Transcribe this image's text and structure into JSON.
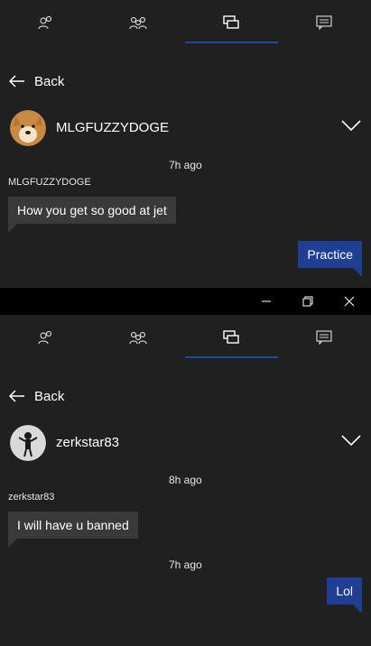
{
  "colors": {
    "background": "#202020",
    "accent": "#1f4a9c",
    "bubble_in": "#3a3a3a",
    "bubble_out": "#1e3f94",
    "titlebar": "#000000"
  },
  "window_controls": {
    "icons": [
      "minimize-icon",
      "maximize-icon",
      "close-icon"
    ]
  },
  "tabs": [
    {
      "icon": "friends-icon"
    },
    {
      "icon": "party-icon"
    },
    {
      "icon": "messages-icon",
      "active": true
    },
    {
      "icon": "notifications-icon"
    }
  ],
  "conversations": [
    {
      "back_label": "Back",
      "contact": {
        "name": "MLGFUZZYDOGE",
        "avatar": "doge-avatar"
      },
      "messages": [
        {
          "type": "time",
          "text": "7h ago"
        },
        {
          "type": "sender",
          "text": "MLGFUZZYDOGE"
        },
        {
          "type": "in",
          "text": "How you get so good at jet"
        },
        {
          "type": "out",
          "text": "Practice"
        }
      ]
    },
    {
      "back_label": "Back",
      "contact": {
        "name": "zerkstar83",
        "avatar": "astronaut-avatar"
      },
      "messages": [
        {
          "type": "time",
          "text": "8h ago"
        },
        {
          "type": "sender",
          "text": "zerkstar83"
        },
        {
          "type": "in",
          "text": "I will have u banned"
        },
        {
          "type": "time",
          "text": "7h ago"
        },
        {
          "type": "out",
          "text": "Lol"
        }
      ]
    }
  ]
}
